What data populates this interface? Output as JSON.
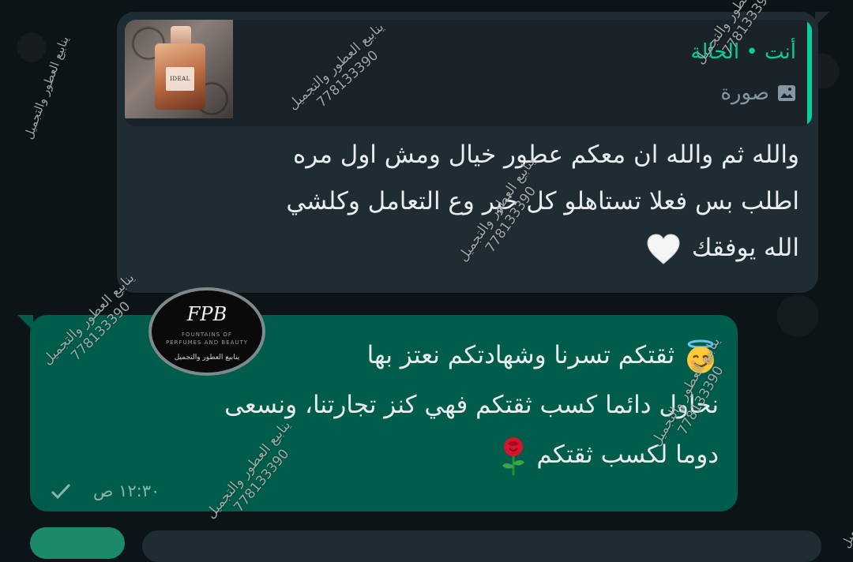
{
  "incoming": {
    "quote": {
      "author": "أنت • الحالة",
      "type_label": "صورة",
      "thumb_label": "IDEAL"
    },
    "lines": [
      "والله ثم والله ان معكم عطور خيال ومش اول مره",
      "اطلب بس فعلا تستاهلو كل خير وع التعامل وكلشي",
      "الله يوفقك"
    ]
  },
  "outgoing": {
    "lines": [
      "ثقتكم تسرنا وشهادتكم نعتز بها",
      "نحاول دائما كسب ثقتكم فهي كنز تجارتنا، ونسعى",
      "دوما لكسب ثقتكم"
    ],
    "time": "١٢:٣٠ ص"
  },
  "avatar": {
    "monogram": "FPB",
    "line1": "FOUNTAINS OF",
    "line2": "PERFUMES AND BEAUTY",
    "arabic": "ينابيع العطور والتجميل"
  },
  "watermark": {
    "name": "ينابيع العطور والتجميل",
    "phone": "778133390"
  },
  "colors": {
    "incoming_bubble": "#202c33",
    "outgoing_bubble": "#005c4b",
    "accent": "#06cf9c",
    "background": "#0b141a"
  }
}
